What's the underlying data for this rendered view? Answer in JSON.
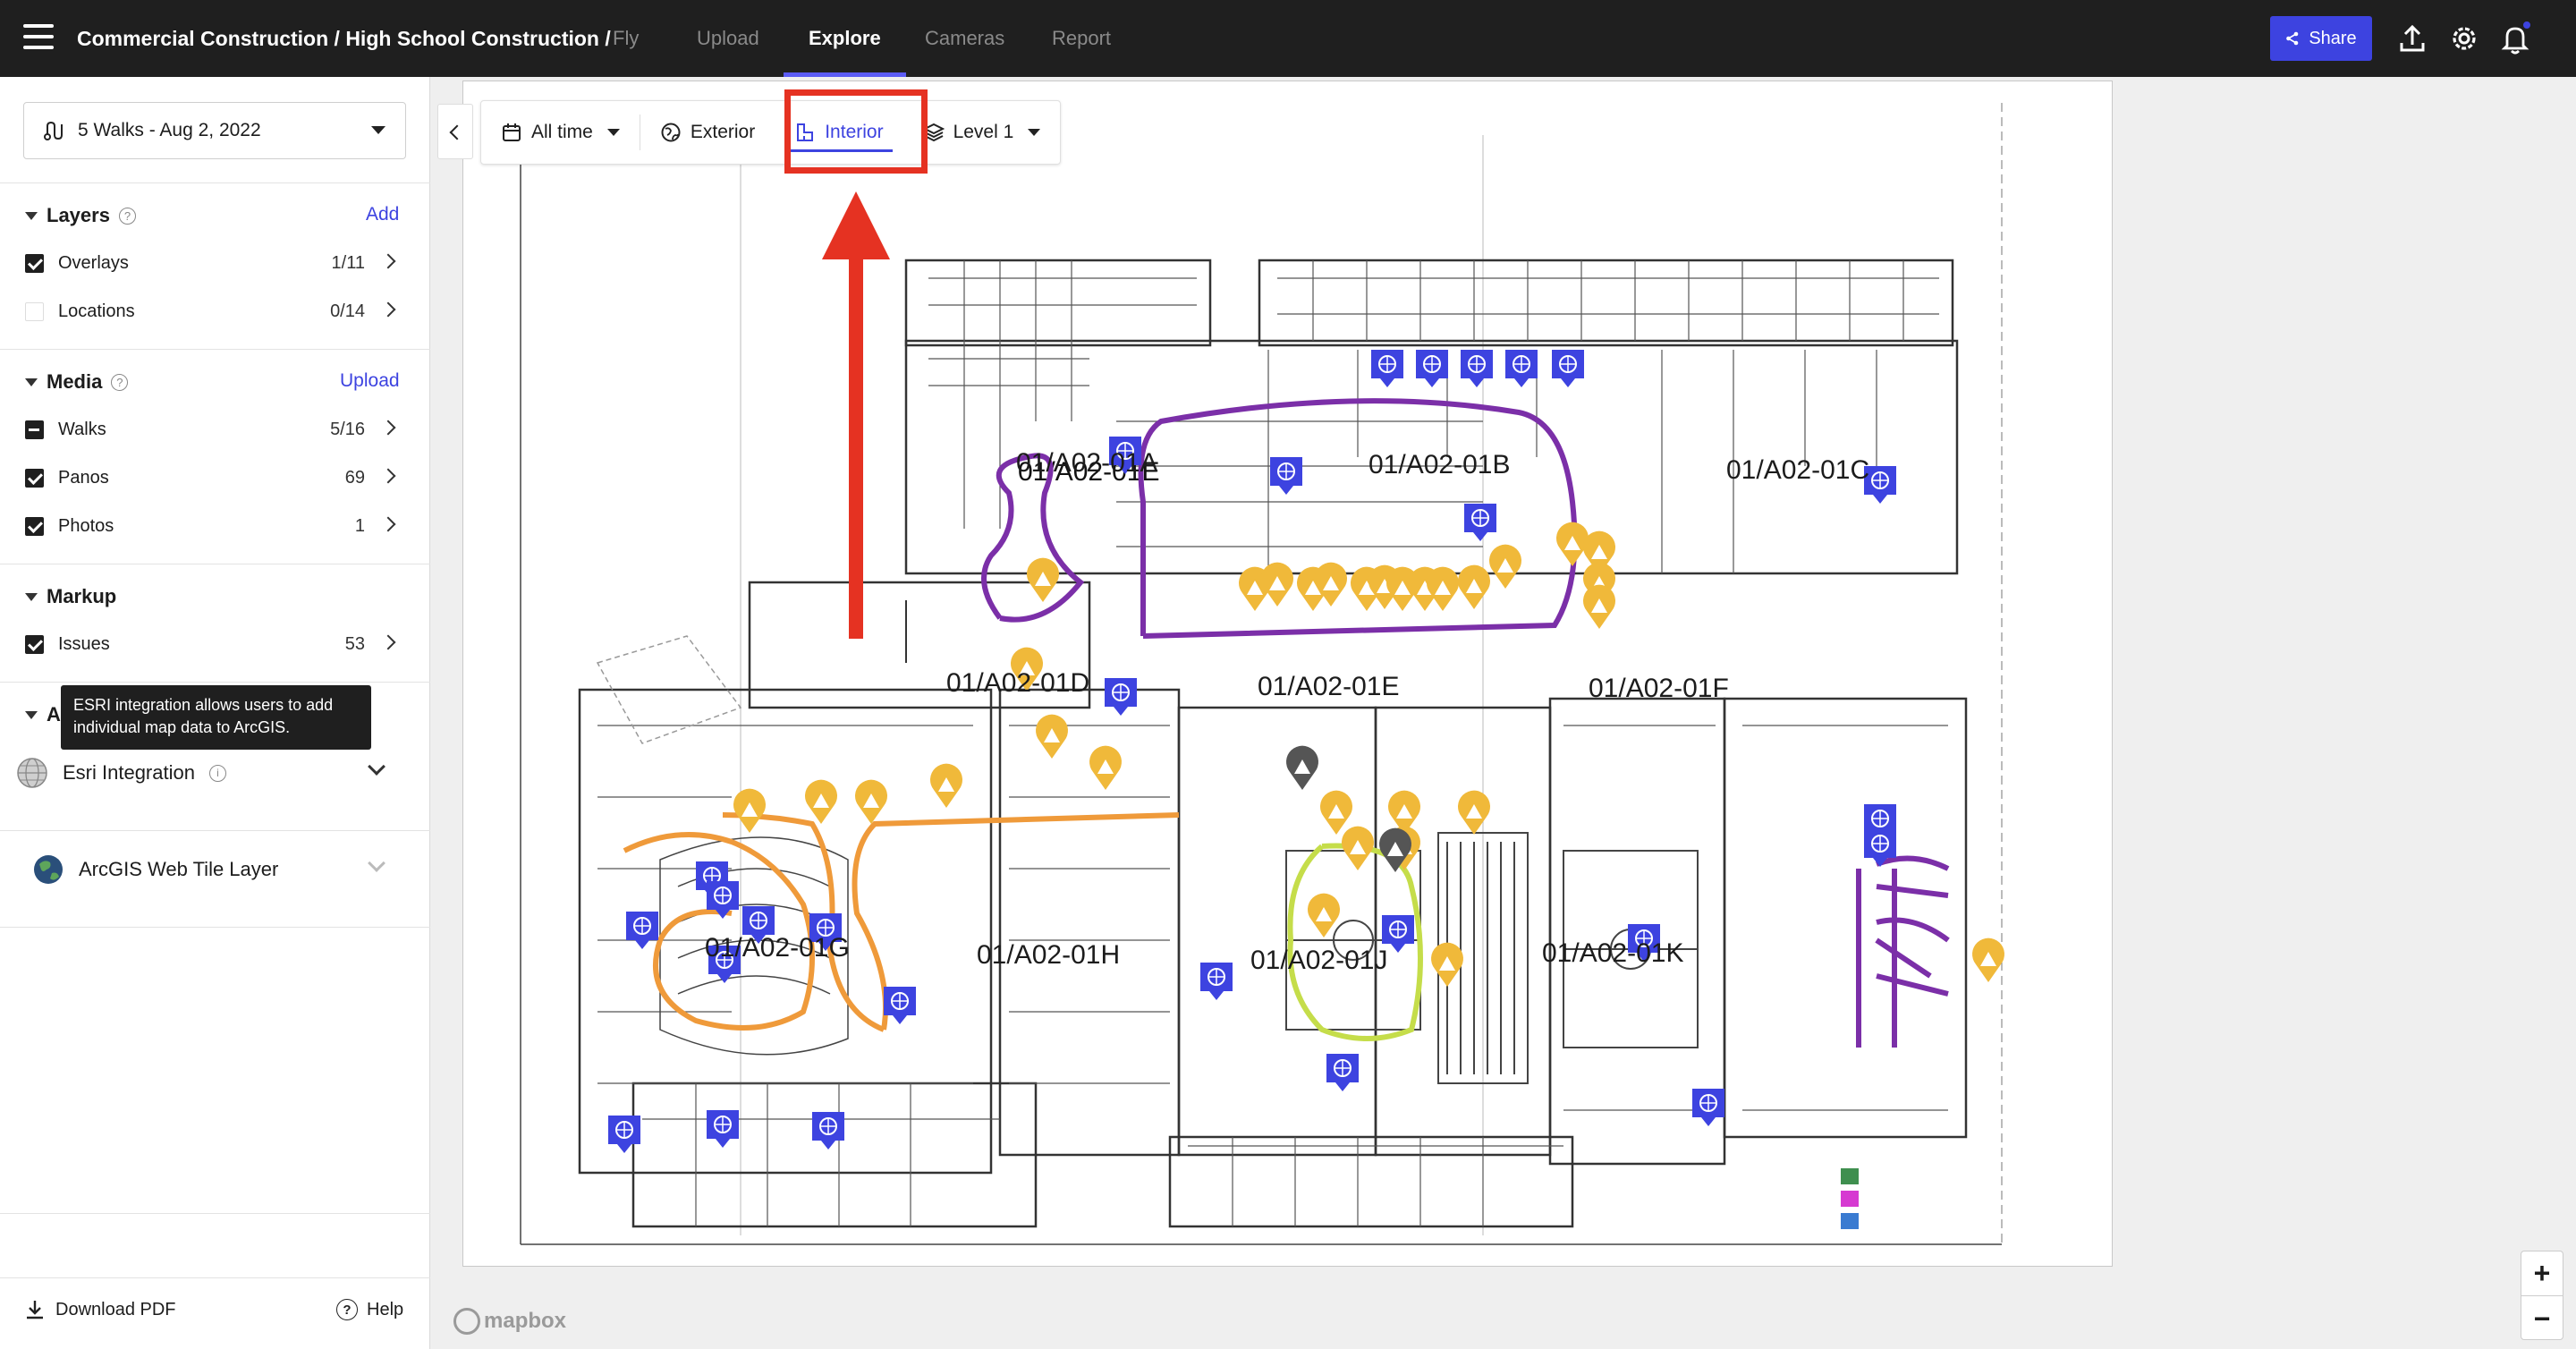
{
  "header": {
    "breadcrumb": "Commercial Construction / High School Construction /",
    "tabs": [
      {
        "label": "Fly",
        "active": false
      },
      {
        "label": "Upload",
        "active": false
      },
      {
        "label": "Explore",
        "active": true
      },
      {
        "label": "Cameras",
        "active": false
      },
      {
        "label": "Report",
        "active": false
      }
    ],
    "share_label": "Share",
    "icons": [
      "menu-icon",
      "share-icon",
      "upload-icon",
      "settings-icon",
      "bell-icon"
    ]
  },
  "sidebar": {
    "walk_selector": "5 Walks - Aug 2, 2022",
    "layers": {
      "title": "Layers",
      "action": "Add",
      "items": [
        {
          "label": "Overlays",
          "count": "1/11",
          "state": "checked"
        },
        {
          "label": "Locations",
          "count": "0/14",
          "state": "empty"
        }
      ]
    },
    "media": {
      "title": "Media",
      "action": "Upload",
      "items": [
        {
          "label": "Walks",
          "count": "5/16",
          "state": "partial"
        },
        {
          "label": "Panos",
          "count": "69",
          "state": "checked"
        },
        {
          "label": "Photos",
          "count": "1",
          "state": "checked"
        }
      ]
    },
    "markup": {
      "title": "Markup",
      "items": [
        {
          "label": "Issues",
          "count": "53",
          "state": "checked"
        }
      ]
    },
    "tooltip": "ESRI integration allows users to add individual map data to ArcGIS.",
    "partial_section_letter": "A",
    "integrations": [
      {
        "label": "Esri Integration"
      },
      {
        "label": "ArcGIS Web Tile Layer"
      }
    ],
    "footer": {
      "download_label": "Download PDF",
      "help_label": "Help"
    }
  },
  "map": {
    "toolbar": {
      "time_label": "All time",
      "exterior_label": "Exterior",
      "interior_label": "Interior",
      "level_label": "Level 1"
    },
    "plan_labels": [
      "01/A02-01A",
      "01/A02-01B",
      "01/A02-01C",
      "01/A02-01D",
      "01/A02-01E",
      "01/A02-01F",
      "01/A02-01G",
      "01/A02-01H",
      "01/A02-01J",
      "01/A02-01K"
    ],
    "zoom_in": "+",
    "zoom_out": "−",
    "attribution": "mapbox",
    "colors": {
      "issue_marker": "#f0b93a",
      "pano_marker": "#3d43e0",
      "walk_purple": "#7b2fa8",
      "walk_orange": "#ef9a3a",
      "walk_green": "#c5dd4a",
      "highlight": "#e53222"
    }
  }
}
